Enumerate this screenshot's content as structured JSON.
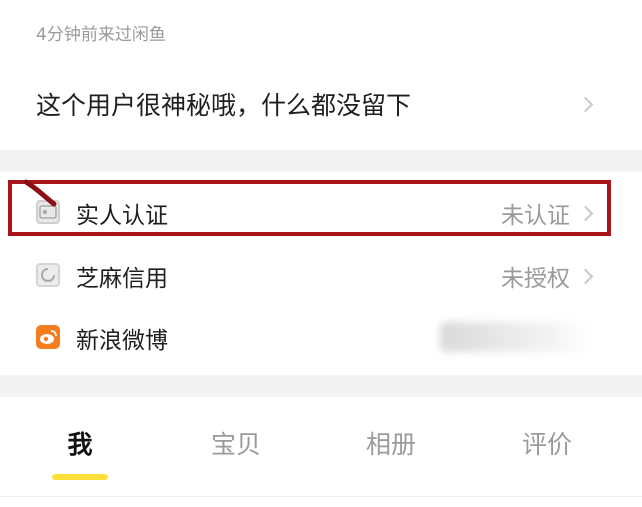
{
  "profile": {
    "last_seen": "4分钟前来过闲鱼",
    "bio": "这个用户很神秘哦，什么都没留下"
  },
  "info_rows": [
    {
      "label": "实人认证",
      "value": "未认证",
      "icon": "id-card-icon"
    },
    {
      "label": "芝麻信用",
      "value": "未授权",
      "icon": "sesame-credit-icon"
    },
    {
      "label": "新浪微博",
      "value": "",
      "icon": "weibo-icon"
    }
  ],
  "tabs": [
    {
      "label": "我",
      "active": true
    },
    {
      "label": "宝贝",
      "active": false
    },
    {
      "label": "相册",
      "active": false
    },
    {
      "label": "评价",
      "active": false
    }
  ],
  "colors": {
    "highlight_border": "#a8161a",
    "tab_indicator": "#ffe03a",
    "weibo_orange": "#f57c1f"
  }
}
